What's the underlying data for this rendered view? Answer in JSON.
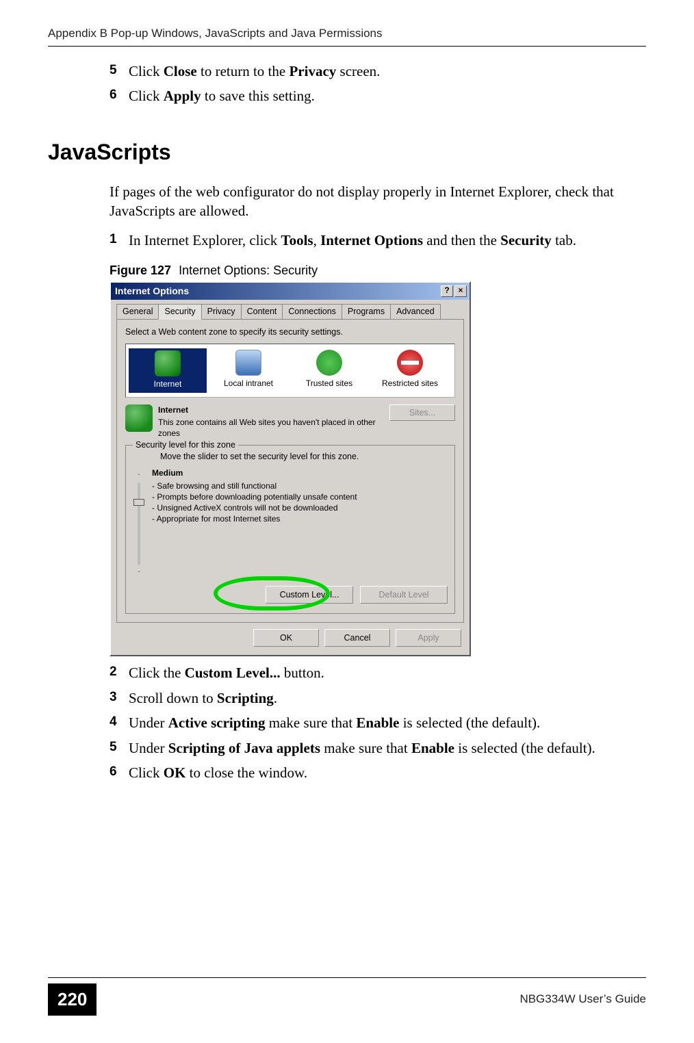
{
  "running_header": "Appendix B Pop-up Windows, JavaScripts and Java Permissions",
  "pre_steps": [
    {
      "num": "5",
      "a": "Click ",
      "b": "Close",
      "c": " to return to the ",
      "d": "Privacy",
      "e": " screen."
    },
    {
      "num": "6",
      "a": "Click ",
      "b": "Apply",
      "c": " to save this setting.",
      "d": "",
      "e": ""
    }
  ],
  "heading": "JavaScripts",
  "intro": "If pages of the web configurator do not display properly in Internet Explorer, check that JavaScripts are allowed.",
  "step1": {
    "num": "1",
    "a": "In Internet Explorer, click ",
    "b": "Tools",
    "c": ", ",
    "d": "Internet Options",
    "e": " and then the ",
    "f": "Security",
    "g": " tab."
  },
  "figure": {
    "label": "Figure 127",
    "title": "Internet Options: Security"
  },
  "dialog": {
    "title": "Internet Options",
    "help_btn": "?",
    "close_btn": "×",
    "tabs": [
      "General",
      "Security",
      "Privacy",
      "Content",
      "Connections",
      "Programs",
      "Advanced"
    ],
    "active_tab_index": 1,
    "instruction": "Select a Web content zone to specify its security settings.",
    "zones": [
      {
        "label": "Internet",
        "icon": "globe"
      },
      {
        "label": "Local intranet",
        "icon": "intranet"
      },
      {
        "label": "Trusted sites",
        "icon": "trusted"
      },
      {
        "label": "Restricted sites",
        "icon": "restricted"
      }
    ],
    "selected_zone_index": 0,
    "zone_title": "Internet",
    "zone_desc": "This zone contains all Web sites you haven't placed in other zones",
    "sites_btn": "Sites...",
    "fieldset_legend": "Security level for this zone",
    "slider_instruction": "Move the slider to set the security level for this zone.",
    "level_name": "Medium",
    "level_bullets": [
      "Safe browsing and still functional",
      "Prompts before downloading potentially unsafe content",
      "Unsigned ActiveX controls will not be downloaded",
      "Appropriate for most Internet sites"
    ],
    "custom_btn": "Custom Level...",
    "default_btn": "Default Level",
    "ok_btn": "OK",
    "cancel_btn": "Cancel",
    "apply_btn": "Apply"
  },
  "post_steps": [
    {
      "num": "2",
      "a": "Click the ",
      "b": "Custom Level...",
      "c": " button.",
      "d": "",
      "e": "",
      "f": "",
      "g": ""
    },
    {
      "num": "3",
      "a": "Scroll down to ",
      "b": "Scripting",
      "c": ".",
      "d": "",
      "e": "",
      "f": "",
      "g": ""
    },
    {
      "num": "4",
      "a": "Under ",
      "b": "Active scripting",
      "c": " make sure that ",
      "d": "Enable",
      "e": " is selected (the default).",
      "f": "",
      "g": ""
    },
    {
      "num": "5",
      "a": "Under ",
      "b": "Scripting of Java applets",
      "c": " make sure that ",
      "d": "Enable",
      "e": " is selected (the default).",
      "f": "",
      "g": ""
    },
    {
      "num": "6",
      "a": "Click ",
      "b": "OK",
      "c": " to close the window.",
      "d": "",
      "e": "",
      "f": "",
      "g": ""
    }
  ],
  "footer": {
    "page": "220",
    "guide": "NBG334W User’s Guide"
  }
}
